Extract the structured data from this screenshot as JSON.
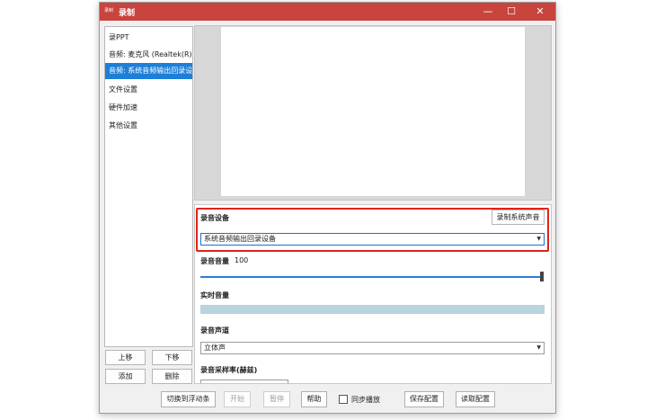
{
  "window": {
    "logo_text": "录制",
    "title": "录制",
    "minimize_glyph": "—",
    "maximize_glyph": "☐",
    "close_glyph": "✕"
  },
  "sidebar": {
    "items": [
      {
        "label": "录PPT",
        "selected": false
      },
      {
        "label": "音频: 麦克风 (Realtek(R) A",
        "selected": false
      },
      {
        "label": "音频: 系统音频输出回录设备",
        "selected": true
      },
      {
        "label": "文件设置",
        "selected": false
      },
      {
        "label": "硬件加速",
        "selected": false
      },
      {
        "label": "其他设置",
        "selected": false
      }
    ],
    "buttons": {
      "up": "上移",
      "down": "下移",
      "add": "添加",
      "delete": "删除"
    }
  },
  "settings": {
    "device_label": "录音设备",
    "record_system_button": "录制系统声音",
    "device_value": "系统音频输出回录设备",
    "volume_label": "录音音量",
    "volume_value": "100",
    "volume_fraction": 1.0,
    "realtime_label": "实时音量",
    "channel_label": "录音声道",
    "channel_value": "立体声",
    "samplerate_label": "录音采样率(赫兹)"
  },
  "bottom": {
    "float_button": "切换到浮动条",
    "start_button": "开始",
    "pause_button": "暂停",
    "help_button": "帮助",
    "sync_play_label": "同步播放",
    "sync_play_checked": false,
    "save_config_button": "保存配置",
    "load_config_button": "读取配置"
  },
  "colors": {
    "titlebar": "#c8443c",
    "selection": "#1e7fd8",
    "highlight_border": "#e0211b",
    "slider": "#2a7fd4",
    "level_bar": "#b8d4dc"
  }
}
